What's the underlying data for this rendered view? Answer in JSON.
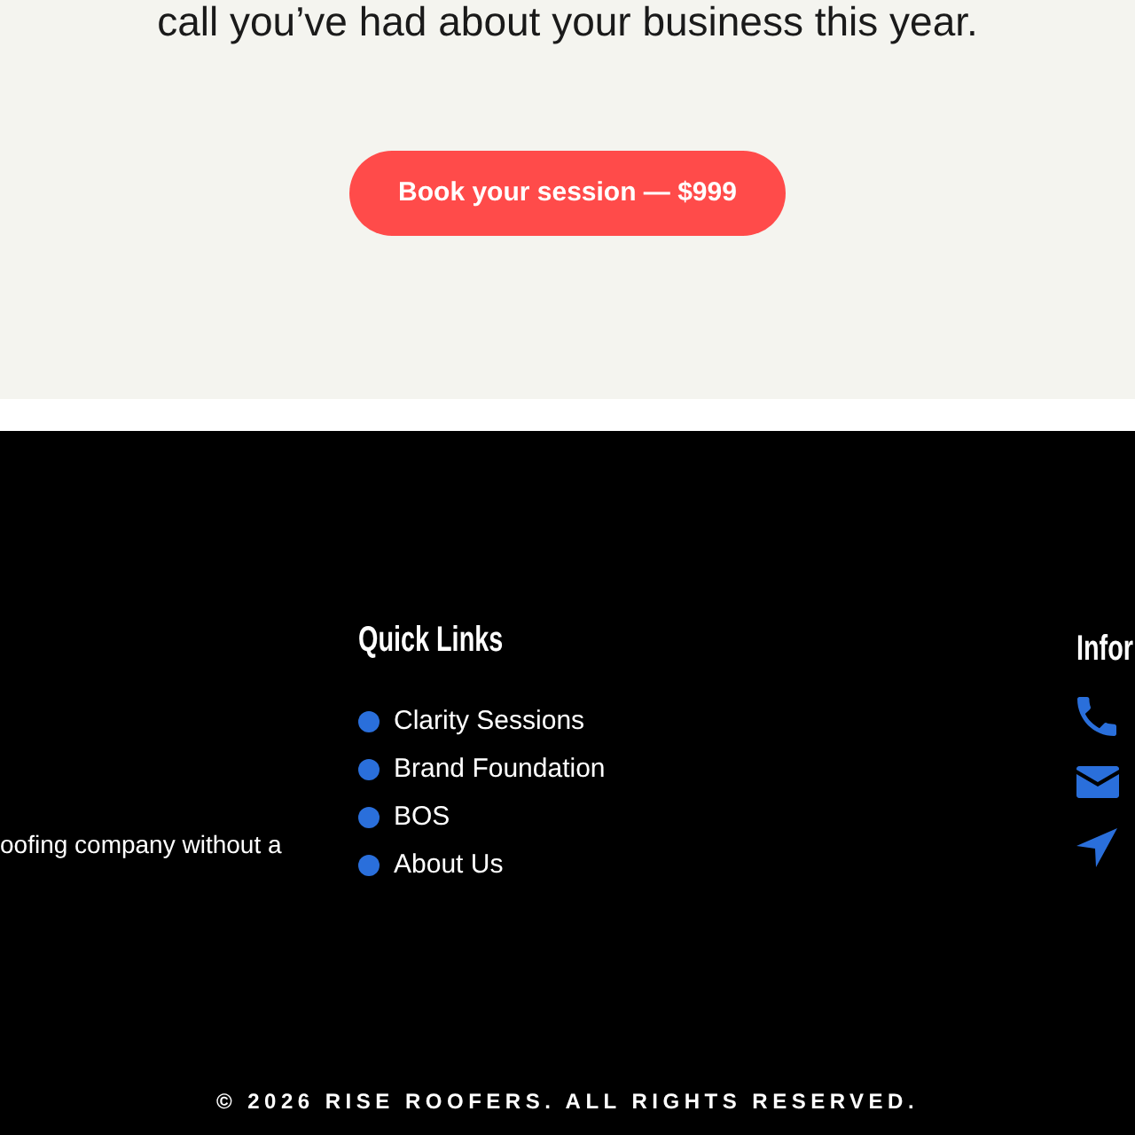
{
  "cta": {
    "text": "call you’ve had about your business this year.",
    "button": "Book your session — $999"
  },
  "footer": {
    "about_text": "oofing company without a",
    "quick_links": {
      "title": "Quick Links",
      "items": [
        "Clarity Sessions",
        "Brand Foundation",
        "BOS",
        "About Us"
      ]
    },
    "info": {
      "title": "Infor",
      "items": [
        {
          "kind": "phone"
        },
        {
          "kind": "email"
        },
        {
          "kind": "location"
        }
      ]
    },
    "copyright": "© 2026 RISE ROOFERS. ALL RIGHTS RESERVED."
  }
}
